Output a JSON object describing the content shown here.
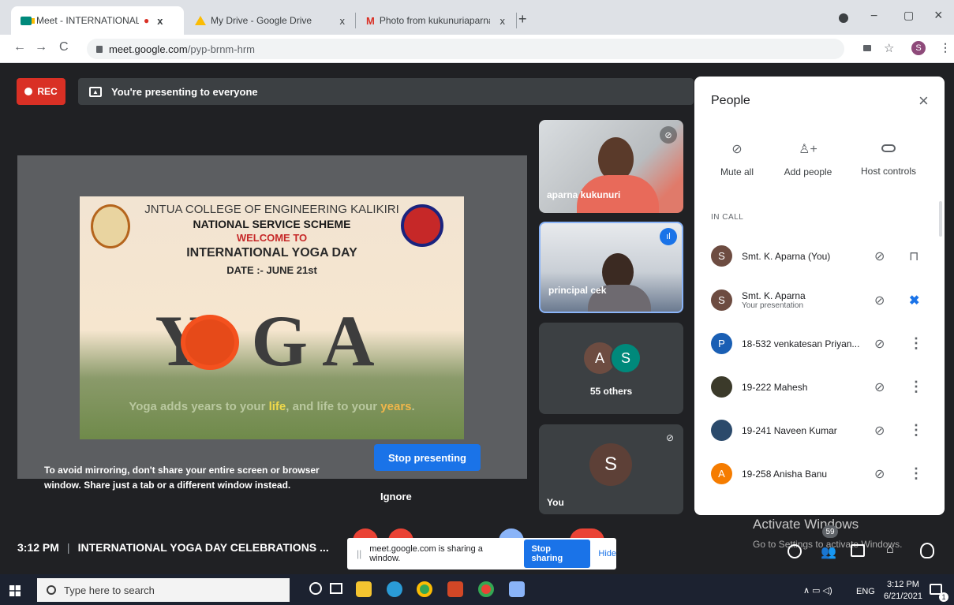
{
  "tabs": [
    {
      "label": "Meet - INTERNATIONAL YOG",
      "icon": "meet-icon",
      "recording": "●",
      "close": "x"
    },
    {
      "label": "My Drive - Google Drive",
      "icon": "drive-icon",
      "close": "x"
    },
    {
      "label": "Photo from kukunuriaparna - apa",
      "icon": "gmail-icon",
      "close": "x"
    }
  ],
  "new_tab": "+",
  "window_controls": {
    "minimize": "−",
    "maximize": "▢",
    "close": "×"
  },
  "nav": {
    "back": "←",
    "forward": "→",
    "reload": "C"
  },
  "address": {
    "host": "meet.google.com",
    "path": "/pyp-brnm-hrm"
  },
  "profile_initial": "S",
  "meet": {
    "rec_label": "REC",
    "presenting_text": "You're presenting to everyone",
    "mirror_warning_line1": "To avoid mirroring, don't share your entire screen or browser",
    "mirror_warning_line2": "window. Share just a tab or a different window instead.",
    "stop_presenting": "Stop presenting",
    "ignore": "Ignore",
    "slide": {
      "college": "JNTUA COLLEGE OF ENGINEERING KALIKIRI",
      "scheme": "NATIONAL SERVICE SCHEME",
      "welcome": "WELCOME TO",
      "event": "INTERNATIONAL YOGA DAY",
      "date": "DATE :- JUNE 21st",
      "yoga_word": "Y  GA",
      "tagline_a": "Yoga adds years to your ",
      "tagline_life": "life",
      "tagline_b": ", and life to your ",
      "tagline_years": "years",
      "tagline_end": "."
    },
    "tiles": [
      {
        "name": "aparna kukunuri"
      },
      {
        "name": "principal cek"
      },
      {
        "name": "55 others",
        "a1": "A",
        "a2": "S"
      },
      {
        "name": "You",
        "avatar": "S"
      }
    ],
    "time": "3:12 PM",
    "separator": "|",
    "meeting_title": "INTERNATIONAL YOGA DAY CELEBRATIONS ...",
    "share_notice": "meet.google.com is sharing a window.",
    "stop_sharing": "Stop sharing",
    "hide": "Hide",
    "participants_badge": "59",
    "activate_title": "Activate Windows",
    "activate_sub": "Go to Settings to activate Windows."
  },
  "people": {
    "title": "People",
    "close": "×",
    "actions": [
      {
        "label": "Mute all",
        "icon": "mic-off-icon"
      },
      {
        "label": "Add people",
        "icon": "add-person-icon"
      },
      {
        "label": "Host controls",
        "icon": "toggle-icon"
      }
    ],
    "section": "IN CALL",
    "list": [
      {
        "initial": "S",
        "name": "Smt. K. Aparna (You)",
        "color": "#6d4c41"
      },
      {
        "initial": "S",
        "name": "Smt. K. Aparna",
        "sub": "Your presentation",
        "color": "#6d4c41"
      },
      {
        "initial": "P",
        "name": "18-532 venkatesan Priyan...",
        "color": "#1a5fb4"
      },
      {
        "initial": "",
        "name": "19-222 Mahesh",
        "color": "#3b3a2a"
      },
      {
        "initial": "",
        "name": "19-241 Naveen Kumar",
        "color": "#2b4a6b"
      },
      {
        "initial": "A",
        "name": "19-258 Anisha Banu",
        "color": "#f57c00"
      }
    ]
  },
  "taskbar": {
    "search_placeholder": "Type here to search",
    "tray_lang": "ENG",
    "clock_time": "3:12 PM",
    "clock_date": "6/21/2021",
    "notifications": "1"
  },
  "colors": {
    "meet_bg": "#202124",
    "accent_blue": "#1a73e8",
    "rec_red": "#d93025"
  }
}
